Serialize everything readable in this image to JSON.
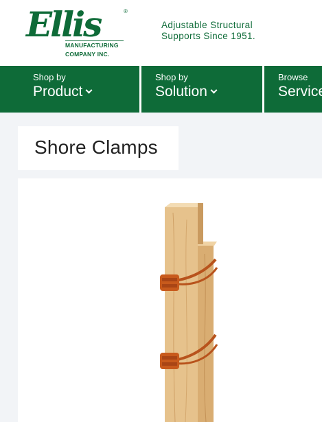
{
  "brand": {
    "logo_word": "Ellis",
    "registered": "®",
    "logo_line1": "MANUFACTURING",
    "logo_line2": "COMPANY INC.",
    "tagline_line1": "Adjustable Structural",
    "tagline_line2": "Supports Since 1951."
  },
  "nav": {
    "items": [
      {
        "small": "Shop by",
        "label": "Product"
      },
      {
        "small": "Shop by",
        "label": "Solution"
      },
      {
        "small": "Browse",
        "label": "Services"
      }
    ]
  },
  "page": {
    "title": "Shore Clamps"
  },
  "colors": {
    "brand_green": "#0e6b38",
    "clamp_orange": "#c85a1c",
    "wood": "#e3bd86",
    "background": "#f2f4f7"
  },
  "product_image": {
    "icon": "shore-clamp-on-wood-post"
  }
}
